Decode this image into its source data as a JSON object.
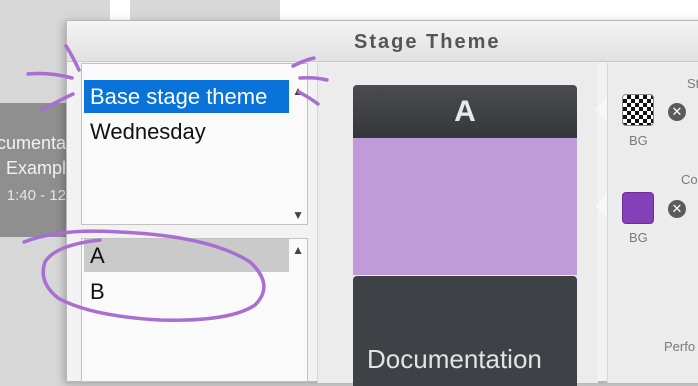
{
  "background": {
    "card": {
      "line1": "ocumenta",
      "line2": "Exampl",
      "line3": "1:40 - 12"
    }
  },
  "dialog": {
    "title": "Stage Theme",
    "theme_list": {
      "items": [
        "Base stage theme",
        "Wednesday"
      ],
      "selected": "Base stage theme"
    },
    "slide_list": {
      "items": [
        "A",
        "B"
      ],
      "highlighted": "A"
    },
    "preview": {
      "header_label": "A",
      "footer_text": "Documentation",
      "body_color": "#c09ad9"
    },
    "settings": {
      "group1": {
        "label": "St",
        "swatch_label": "BG",
        "swatch_type": "checkerboard",
        "clear_icon": "close-circle-icon"
      },
      "group2": {
        "label": "Co",
        "swatch_label": "BG",
        "swatch_color": "#8340b8",
        "clear_icon": "close-circle-icon"
      },
      "group3": {
        "label": "Perfo"
      }
    }
  },
  "annotation_color": "#a86fd1"
}
